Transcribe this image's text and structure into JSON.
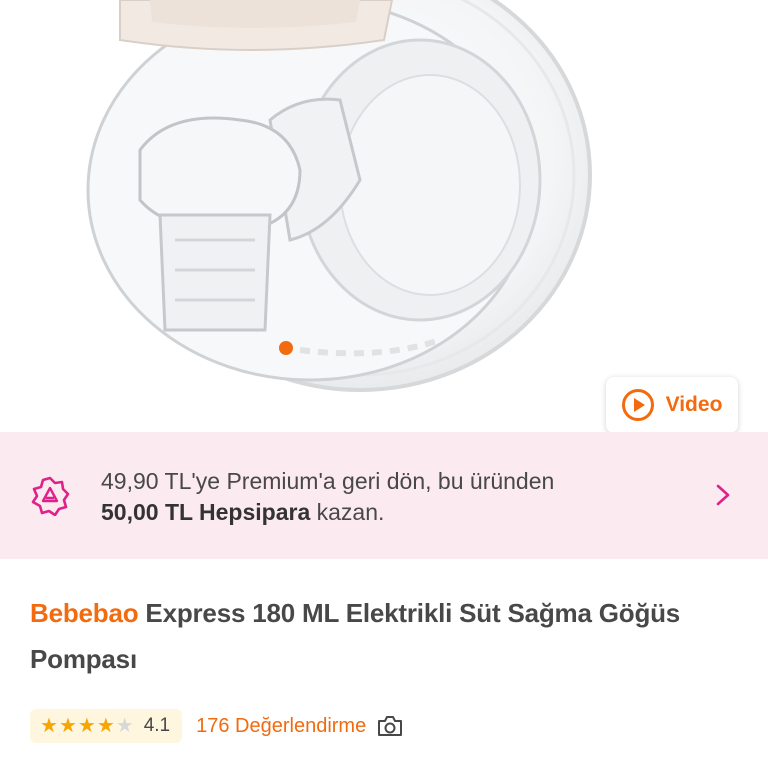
{
  "gallery": {
    "image_alt": "Bebebao Express 180 ML Elektrikli Süt Sağma Göğüs Pompası",
    "active_dot": 1,
    "video_label": "Video",
    "icons": {
      "play": "play-circle-icon"
    }
  },
  "promo": {
    "line1": "49,90 TL'ye Premium'a geri dön, bu üründen",
    "amount": "50,00 TL Hepsipara",
    "line2_suffix": " kazan.",
    "icons": {
      "badge": "premium-badge-icon",
      "chevron": "chevron-right-icon"
    },
    "background": "#fbeaf0",
    "accent": "#e0218a"
  },
  "product": {
    "brand": "Bebebao",
    "name": " Express 180 ML Elektrikli Süt Sağma Göğüs Pompası"
  },
  "rating": {
    "stars": 4,
    "max": 5,
    "score": "4.1",
    "reviews": "176 Değerlendirme",
    "icons": {
      "camera": "camera-icon",
      "star": "star-icon"
    }
  },
  "colors": {
    "accent": "#f26b0f",
    "star": "#f7a500",
    "text": "#484848"
  }
}
